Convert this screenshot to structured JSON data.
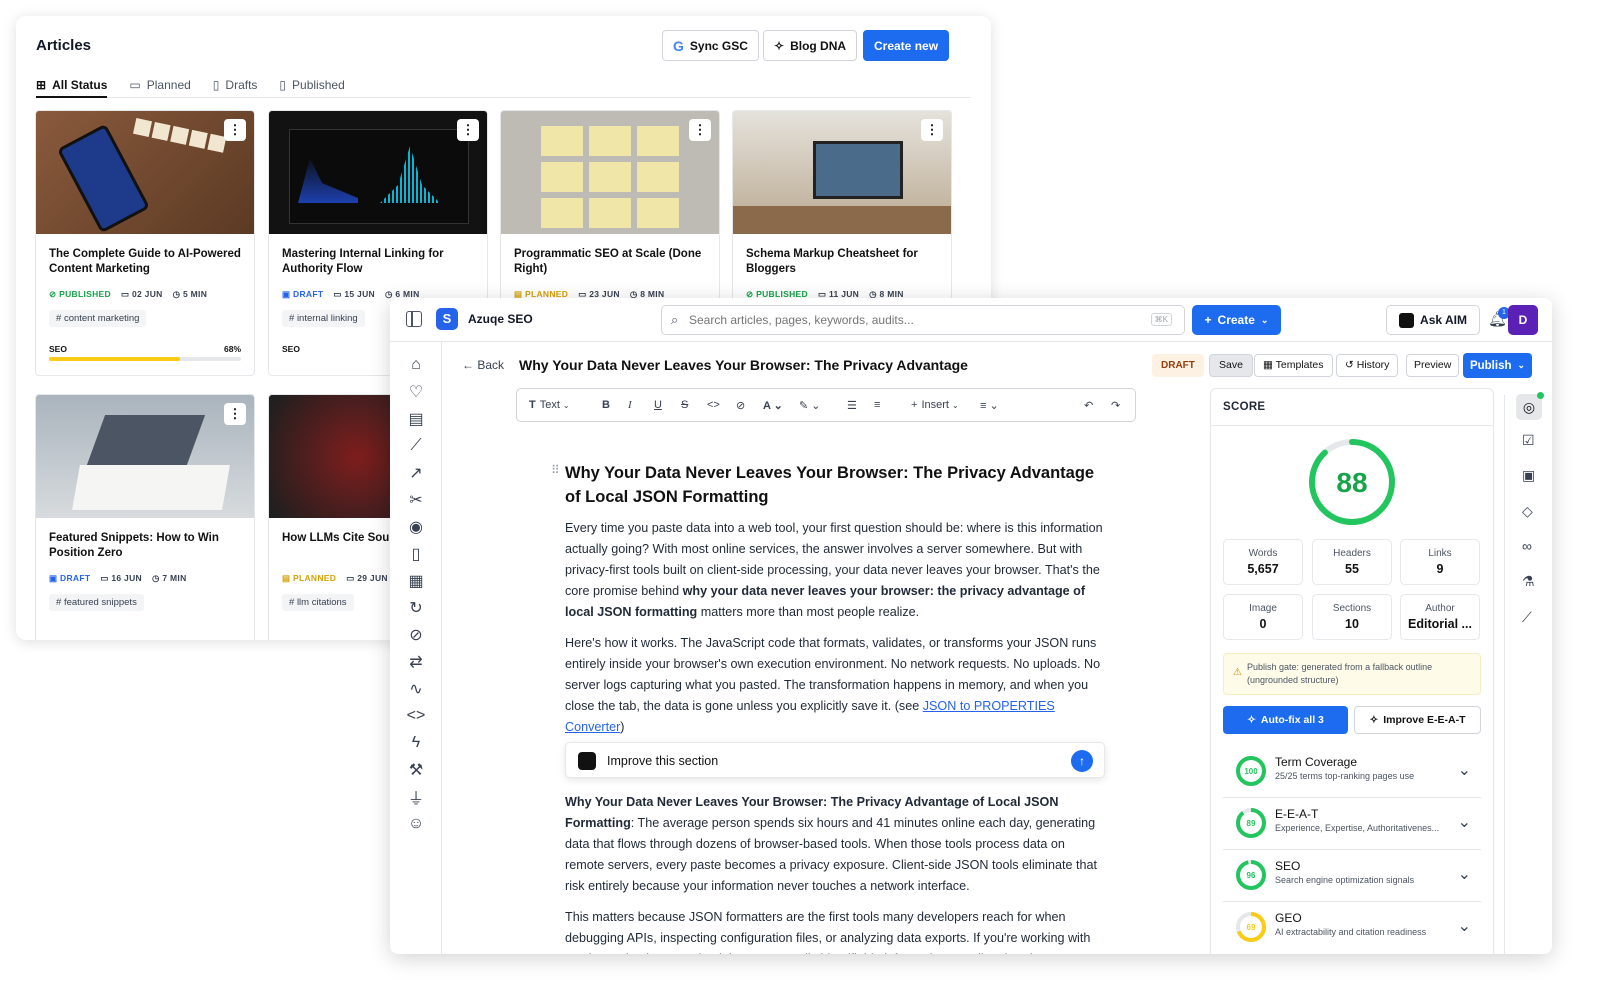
{
  "articles": {
    "title": "Articles",
    "buttons": {
      "sync": "Sync GSC",
      "dna": "Blog DNA",
      "create": "Create new"
    },
    "tabs": [
      "All Status",
      "Planned",
      "Drafts",
      "Published"
    ],
    "cards": [
      {
        "title": "The Complete Guide to AI-Powered Content Marketing",
        "status": "PUBLISHED",
        "date": "02 JUN",
        "read": "5 MIN",
        "tag": "content marketing",
        "seo_label": "SEO",
        "seo_pct": "68%",
        "seo_value": 68
      },
      {
        "title": "Mastering Internal Linking for Authority Flow",
        "status": "DRAFT",
        "date": "15 JUN",
        "read": "6 MIN",
        "tag": "internal linking",
        "seo_label": "SEO"
      },
      {
        "title": "Programmatic SEO at Scale (Done Right)",
        "status": "PLANNED",
        "date": "23 JUN",
        "read": "8 MIN"
      },
      {
        "title": "Schema Markup Cheatsheet for Bloggers",
        "status": "PUBLISHED",
        "date": "11 JUN",
        "read": "8 MIN"
      },
      {
        "title": "Featured Snippets: How to Win Position Zero",
        "status": "DRAFT",
        "date": "16 JUN",
        "read": "7 MIN",
        "tag": "featured snippets"
      },
      {
        "title": "How LLMs Cite Sourc to Get Cited)",
        "status": "PLANNED",
        "date": "29 JUN",
        "tag": "llm citations"
      }
    ]
  },
  "editor": {
    "app_name": "Azuqe SEO",
    "search": {
      "placeholder": "Search articles, pages, keywords, audits...",
      "shortcut": "⌘K"
    },
    "create_label": "Create",
    "ask_label": "Ask AIM",
    "notif_count": "1",
    "avatar": "D",
    "back_label": "Back",
    "doc_title": "Why Your Data Never Leaves Your Browser: The Privacy Advantage",
    "status_badge": "DRAFT",
    "actions": {
      "save": "Save",
      "templates": "Templates",
      "history": "History",
      "preview": "Preview",
      "publish": "Publish"
    },
    "toolbar": {
      "text": "Text",
      "insert": "Insert"
    },
    "content": {
      "heading": "Why Your Data Never Leaves Your Browser: The Privacy Advantage of Local JSON Formatting",
      "p1_a": "Every time you paste data into a web tool, your first question should be: where is this information actually going? With most online services, the answer involves a server somewhere. But with privacy-first tools built on client-side processing, your data never leaves your browser. That's the core promise behind ",
      "p1_bold": "why your data never leaves your browser: the privacy advantage of local JSON formatting",
      "p1_b": " matters more than most people realize.",
      "p2_a": "Here's how it works. The JavaScript code that formats, validates, or transforms your JSON runs entirely inside your browser's own execution environment. No network requests. No uploads. No server logs capturing what you pasted. The transformation happens in memory, and when you close the tab, the data is gone unless you explicitly save it. (see ",
      "p2_link": "JSON to PROPERTIES Converter",
      "p2_b": ")",
      "ai_prompt": "Improve this section",
      "p3_bold": "Why Your Data Never Leaves Your Browser: The Privacy Advantage of Local JSON Formatting",
      "p3_rest": ": The average person spends six hours and 41 minutes online each day, generating data that flows through dozens of browser-based tools. When those tools process data on remote servers, every paste becomes a privacy exposure. Client-side JSON tools eliminate that risk entirely because your information never touches a network interface.",
      "p4": "This matters because JSON formatters are the first tools many developers reach for when debugging APIs, inspecting configuration files, or analyzing data exports. If you're working with API keys, database credentials, or personally identifiable information, sending that data"
    },
    "score": {
      "label": "SCORE",
      "value": "88",
      "stats": [
        {
          "label": "Words",
          "value": "5,657"
        },
        {
          "label": "Headers",
          "value": "55"
        },
        {
          "label": "Links",
          "value": "9"
        },
        {
          "label": "Image",
          "value": "0"
        },
        {
          "label": "Sections",
          "value": "10"
        },
        {
          "label": "Author",
          "value": "Editorial ..."
        }
      ],
      "warning": "Publish gate: generated from a fallback outline (ungrounded structure)",
      "autofix": "Auto-fix all 3",
      "improve": "Improve E-E-A-T",
      "metrics": [
        {
          "title": "Term Coverage",
          "sub": "25/25 terms top-ranking pages use",
          "score": "100",
          "color": "#22c55e"
        },
        {
          "title": "E-E-A-T",
          "sub": "Experience, Expertise, Authoritativenes...",
          "score": "89",
          "color": "#22c55e"
        },
        {
          "title": "SEO",
          "sub": "Search engine optimization signals",
          "score": "96",
          "color": "#22c55e"
        },
        {
          "title": "GEO",
          "sub": "AI extractability and citation readiness",
          "score": "69",
          "color": "#facc15"
        }
      ]
    }
  }
}
